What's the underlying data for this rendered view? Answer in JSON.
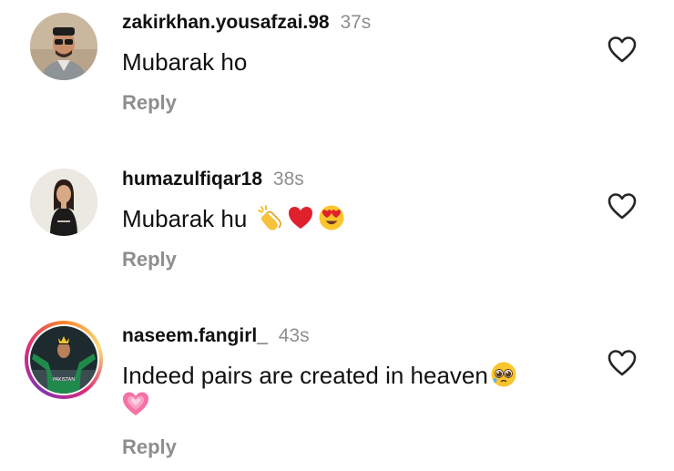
{
  "comments": [
    {
      "username": "zakirkhan.yousafzai.98",
      "time": "37s",
      "text": "Mubarak ho",
      "reply_label": "Reply"
    },
    {
      "username": "humazulfiqar18",
      "time": "38s",
      "text": "Mubarak hu",
      "emojis": [
        "clapping-hands",
        "red-heart",
        "heart-eyes-face"
      ],
      "reply_label": "Reply"
    },
    {
      "username": "naseem.fangirl_",
      "time": "43s",
      "text": "Indeed pairs are created in heaven",
      "emojis": [
        "pleading-face",
        "growing-heart"
      ],
      "reply_label": "Reply",
      "has_story_ring": true
    }
  ],
  "icons": {
    "like": "heart-outline-icon"
  },
  "colors": {
    "text": "#111111",
    "muted": "#8e8e8e",
    "background": "#ffffff"
  }
}
